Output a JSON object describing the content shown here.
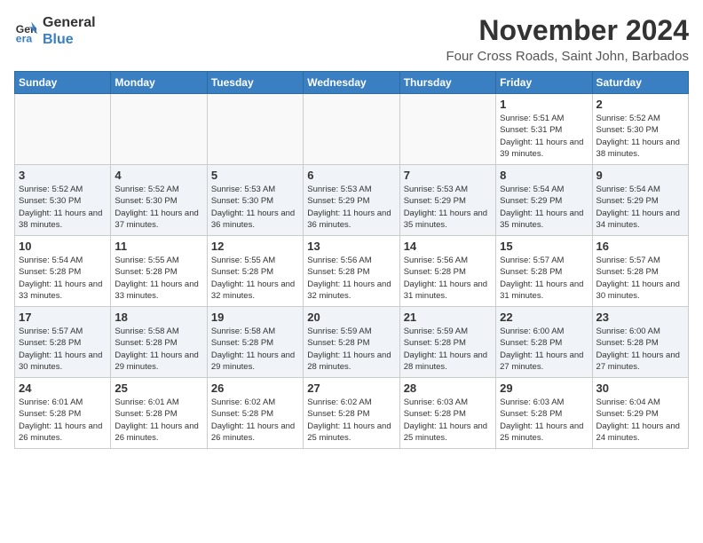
{
  "header": {
    "logo_line1": "General",
    "logo_line2": "Blue",
    "month_year": "November 2024",
    "location": "Four Cross Roads, Saint John, Barbados"
  },
  "weekdays": [
    "Sunday",
    "Monday",
    "Tuesday",
    "Wednesday",
    "Thursday",
    "Friday",
    "Saturday"
  ],
  "weeks": [
    [
      {
        "day": "",
        "info": ""
      },
      {
        "day": "",
        "info": ""
      },
      {
        "day": "",
        "info": ""
      },
      {
        "day": "",
        "info": ""
      },
      {
        "day": "",
        "info": ""
      },
      {
        "day": "1",
        "info": "Sunrise: 5:51 AM\nSunset: 5:31 PM\nDaylight: 11 hours and 39 minutes."
      },
      {
        "day": "2",
        "info": "Sunrise: 5:52 AM\nSunset: 5:30 PM\nDaylight: 11 hours and 38 minutes."
      }
    ],
    [
      {
        "day": "3",
        "info": "Sunrise: 5:52 AM\nSunset: 5:30 PM\nDaylight: 11 hours and 38 minutes."
      },
      {
        "day": "4",
        "info": "Sunrise: 5:52 AM\nSunset: 5:30 PM\nDaylight: 11 hours and 37 minutes."
      },
      {
        "day": "5",
        "info": "Sunrise: 5:53 AM\nSunset: 5:30 PM\nDaylight: 11 hours and 36 minutes."
      },
      {
        "day": "6",
        "info": "Sunrise: 5:53 AM\nSunset: 5:29 PM\nDaylight: 11 hours and 36 minutes."
      },
      {
        "day": "7",
        "info": "Sunrise: 5:53 AM\nSunset: 5:29 PM\nDaylight: 11 hours and 35 minutes."
      },
      {
        "day": "8",
        "info": "Sunrise: 5:54 AM\nSunset: 5:29 PM\nDaylight: 11 hours and 35 minutes."
      },
      {
        "day": "9",
        "info": "Sunrise: 5:54 AM\nSunset: 5:29 PM\nDaylight: 11 hours and 34 minutes."
      }
    ],
    [
      {
        "day": "10",
        "info": "Sunrise: 5:54 AM\nSunset: 5:28 PM\nDaylight: 11 hours and 33 minutes."
      },
      {
        "day": "11",
        "info": "Sunrise: 5:55 AM\nSunset: 5:28 PM\nDaylight: 11 hours and 33 minutes."
      },
      {
        "day": "12",
        "info": "Sunrise: 5:55 AM\nSunset: 5:28 PM\nDaylight: 11 hours and 32 minutes."
      },
      {
        "day": "13",
        "info": "Sunrise: 5:56 AM\nSunset: 5:28 PM\nDaylight: 11 hours and 32 minutes."
      },
      {
        "day": "14",
        "info": "Sunrise: 5:56 AM\nSunset: 5:28 PM\nDaylight: 11 hours and 31 minutes."
      },
      {
        "day": "15",
        "info": "Sunrise: 5:57 AM\nSunset: 5:28 PM\nDaylight: 11 hours and 31 minutes."
      },
      {
        "day": "16",
        "info": "Sunrise: 5:57 AM\nSunset: 5:28 PM\nDaylight: 11 hours and 30 minutes."
      }
    ],
    [
      {
        "day": "17",
        "info": "Sunrise: 5:57 AM\nSunset: 5:28 PM\nDaylight: 11 hours and 30 minutes."
      },
      {
        "day": "18",
        "info": "Sunrise: 5:58 AM\nSunset: 5:28 PM\nDaylight: 11 hours and 29 minutes."
      },
      {
        "day": "19",
        "info": "Sunrise: 5:58 AM\nSunset: 5:28 PM\nDaylight: 11 hours and 29 minutes."
      },
      {
        "day": "20",
        "info": "Sunrise: 5:59 AM\nSunset: 5:28 PM\nDaylight: 11 hours and 28 minutes."
      },
      {
        "day": "21",
        "info": "Sunrise: 5:59 AM\nSunset: 5:28 PM\nDaylight: 11 hours and 28 minutes."
      },
      {
        "day": "22",
        "info": "Sunrise: 6:00 AM\nSunset: 5:28 PM\nDaylight: 11 hours and 27 minutes."
      },
      {
        "day": "23",
        "info": "Sunrise: 6:00 AM\nSunset: 5:28 PM\nDaylight: 11 hours and 27 minutes."
      }
    ],
    [
      {
        "day": "24",
        "info": "Sunrise: 6:01 AM\nSunset: 5:28 PM\nDaylight: 11 hours and 26 minutes."
      },
      {
        "day": "25",
        "info": "Sunrise: 6:01 AM\nSunset: 5:28 PM\nDaylight: 11 hours and 26 minutes."
      },
      {
        "day": "26",
        "info": "Sunrise: 6:02 AM\nSunset: 5:28 PM\nDaylight: 11 hours and 26 minutes."
      },
      {
        "day": "27",
        "info": "Sunrise: 6:02 AM\nSunset: 5:28 PM\nDaylight: 11 hours and 25 minutes."
      },
      {
        "day": "28",
        "info": "Sunrise: 6:03 AM\nSunset: 5:28 PM\nDaylight: 11 hours and 25 minutes."
      },
      {
        "day": "29",
        "info": "Sunrise: 6:03 AM\nSunset: 5:28 PM\nDaylight: 11 hours and 25 minutes."
      },
      {
        "day": "30",
        "info": "Sunrise: 6:04 AM\nSunset: 5:29 PM\nDaylight: 11 hours and 24 minutes."
      }
    ]
  ]
}
